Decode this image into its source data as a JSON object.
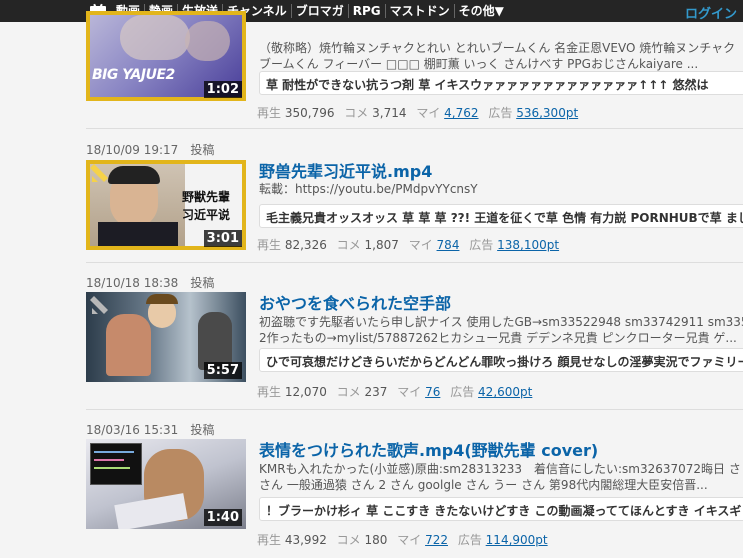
{
  "nav": {
    "items": [
      "動画",
      "静画",
      "生放送",
      "チャンネル",
      "ブロマガ",
      "RPG",
      "マストドン",
      "その他▼"
    ],
    "login": "ログイン"
  },
  "videos": [
    {
      "duration": "1:02",
      "thumb_text": "BIG YAJUE2",
      "desc_lines": [
        "（敬称略）焼竹輪ヌンチャクとれい とれいブームくん 名金正恩VEVO 焼竹輪ヌンチャク",
        "ブームくん フィーバー □□□ 棚町薫 いっく さんけべす PPGおじさんkaiyare ..."
      ],
      "comment": "草 耐性ができない抗うつ剤 草 イキスウァァァァァァァァァァァァァ↑↑↑ 悠然は",
      "stats": {
        "play_label": "再生",
        "play": "350,796",
        "comment_label": "コメ",
        "comments": "3,714",
        "mylist_label": "マイ",
        "mylist": "4,762",
        "ad_label": "広告",
        "ad": "536,300pt"
      }
    },
    {
      "date": "18/10/09 19:17",
      "posted": "投稿",
      "duration": "3:01",
      "thumb_text_1": "野獣先輩",
      "thumb_text_2": "习近平说",
      "title": "野兽先辈习近平说.mp4",
      "desc_lines": [
        "転載：https://youtu.be/PMdpvYYcnsY"
      ],
      "comment": "毛主義兄貴オッスオッス 草 草 草 ??! 王道を征くで草 色情 有力説 PORNHUBで草 まじ",
      "stats": {
        "play_label": "再生",
        "play": "82,326",
        "comment_label": "コメ",
        "comments": "1,807",
        "mylist_label": "マイ",
        "mylist": "784",
        "ad_label": "広告",
        "ad": "138,100pt"
      }
    },
    {
      "date": "18/10/18 18:38",
      "posted": "投稿",
      "duration": "5:57",
      "title": "おやつを食べられた空手部",
      "desc_lines": [
        "初盗聴です先駆者いたら申し訳ナイス 使用したGB→sm33522948 sm33742911 sm335",
        "2作ったもの→mylist/57887262ヒカシュー兄貴 デデンネ兄貴 ピンクローター兄貴 ゲ..."
      ],
      "comment": "ひで可哀想だけどきらいだからどんどん罪吹っ掛けろ 顔見せなしの淫夢実況でファミリー",
      "stats": {
        "play_label": "再生",
        "play": "12,070",
        "comment_label": "コメ",
        "comments": "237",
        "mylist_label": "マイ",
        "mylist": "76",
        "ad_label": "広告",
        "ad": "42,600pt"
      }
    },
    {
      "date": "18/03/16 15:31",
      "posted": "投稿",
      "duration": "1:40",
      "title": "表情をつけられた歌声.mp4(野獣先輩 cover)",
      "desc_lines": [
        "KMRも入れたかった(小並感)原曲:sm28313233　着信音にしたい:sm32637072晦日 さ",
        "さん 一般通過猿 さん 2 さん goolgle さん うー さん 第98代内閣総理大臣安倍晋..."
      ],
      "comment": "！ブラーかけ杉ィ 草 ここすき きたないけどすき この動画凝っててほんとすき イキスギ",
      "stats": {
        "play_label": "再生",
        "play": "43,992",
        "comment_label": "コメ",
        "comments": "180",
        "mylist_label": "マイ",
        "mylist": "722",
        "ad_label": "広告",
        "ad": "114,900pt"
      }
    }
  ],
  "colors": {
    "topbar": "#252525",
    "link": "#0b64a8",
    "gold_frame": "#e2b51b",
    "silver_badge": "#999999"
  }
}
